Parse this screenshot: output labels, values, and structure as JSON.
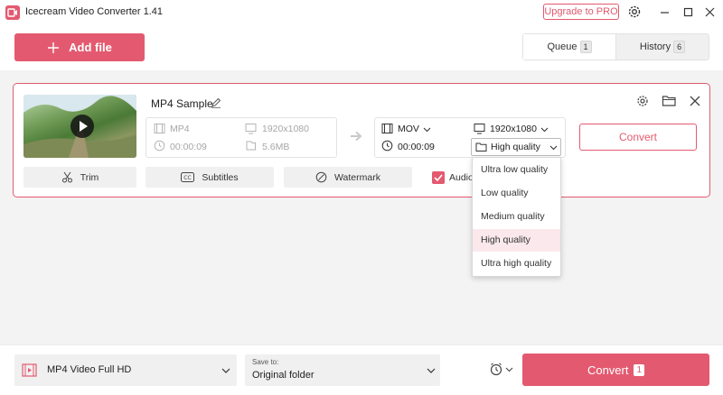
{
  "app": {
    "title": "Icecream Video Converter 1.41",
    "upgrade_label": "Upgrade to PRO"
  },
  "header": {
    "add_file_label": "Add file",
    "tabs": [
      {
        "label": "Queue",
        "count": "1",
        "active": true
      },
      {
        "label": "History",
        "count": "6",
        "active": false
      }
    ]
  },
  "file": {
    "name": "MP4 Sample",
    "source": {
      "format": "MP4",
      "resolution": "1920x1080",
      "duration": "00:00:09",
      "size": "5.6MB"
    },
    "output": {
      "format": "MOV",
      "resolution": "1920x1080",
      "duration": "00:00:09",
      "quality": "High quality"
    },
    "convert_label": "Convert",
    "tools": {
      "trim": "Trim",
      "subtitles": "Subtitles",
      "watermark": "Watermark",
      "audio": "Audio"
    }
  },
  "quality_menu": {
    "options": [
      "Ultra low quality",
      "Low quality",
      "Medium quality",
      "High quality",
      "Ultra high quality"
    ],
    "selected": "High quality"
  },
  "footer": {
    "preset": "MP4 Video Full HD",
    "save_to_label": "Save to:",
    "save_to_value": "Original folder",
    "convert_label": "Convert",
    "convert_count": "1"
  },
  "colors": {
    "accent": "#e35a70",
    "selected_bg": "#fbe8ec",
    "background": "#f3f3f3"
  },
  "icons": [
    "app-logo-icon",
    "gear-icon",
    "minimize-icon",
    "maximize-icon",
    "close-icon",
    "plus-icon",
    "play-icon",
    "pencil-icon",
    "film-icon",
    "screen-icon",
    "clock-icon",
    "file-icon",
    "arrow-right-icon",
    "chevron-down-icon",
    "folder-icon",
    "scissors-icon",
    "cc-icon",
    "watermark-icon",
    "check-icon",
    "alarm-icon"
  ]
}
